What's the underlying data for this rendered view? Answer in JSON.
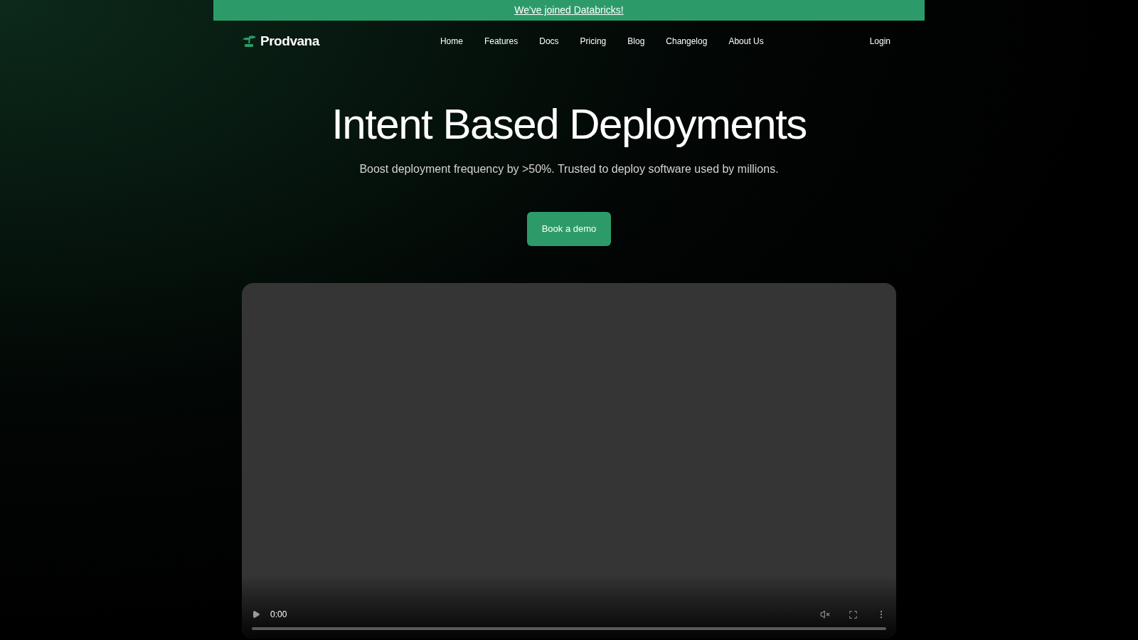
{
  "banner": {
    "link": "We've joined Databricks!"
  },
  "nav": {
    "brand": "Prodvana",
    "links": [
      "Home",
      "Features",
      "Docs",
      "Pricing",
      "Blog",
      "Changelog",
      "About Us"
    ],
    "login": "Login"
  },
  "hero": {
    "title": "Intent Based Deployments",
    "subtitle": "Boost deployment frequency by >50%. Trusted to deploy software used by millions.",
    "button": "Book a demo"
  },
  "video": {
    "time": "0:00",
    "muted": true,
    "progress": {
      "level": 0
    }
  }
}
